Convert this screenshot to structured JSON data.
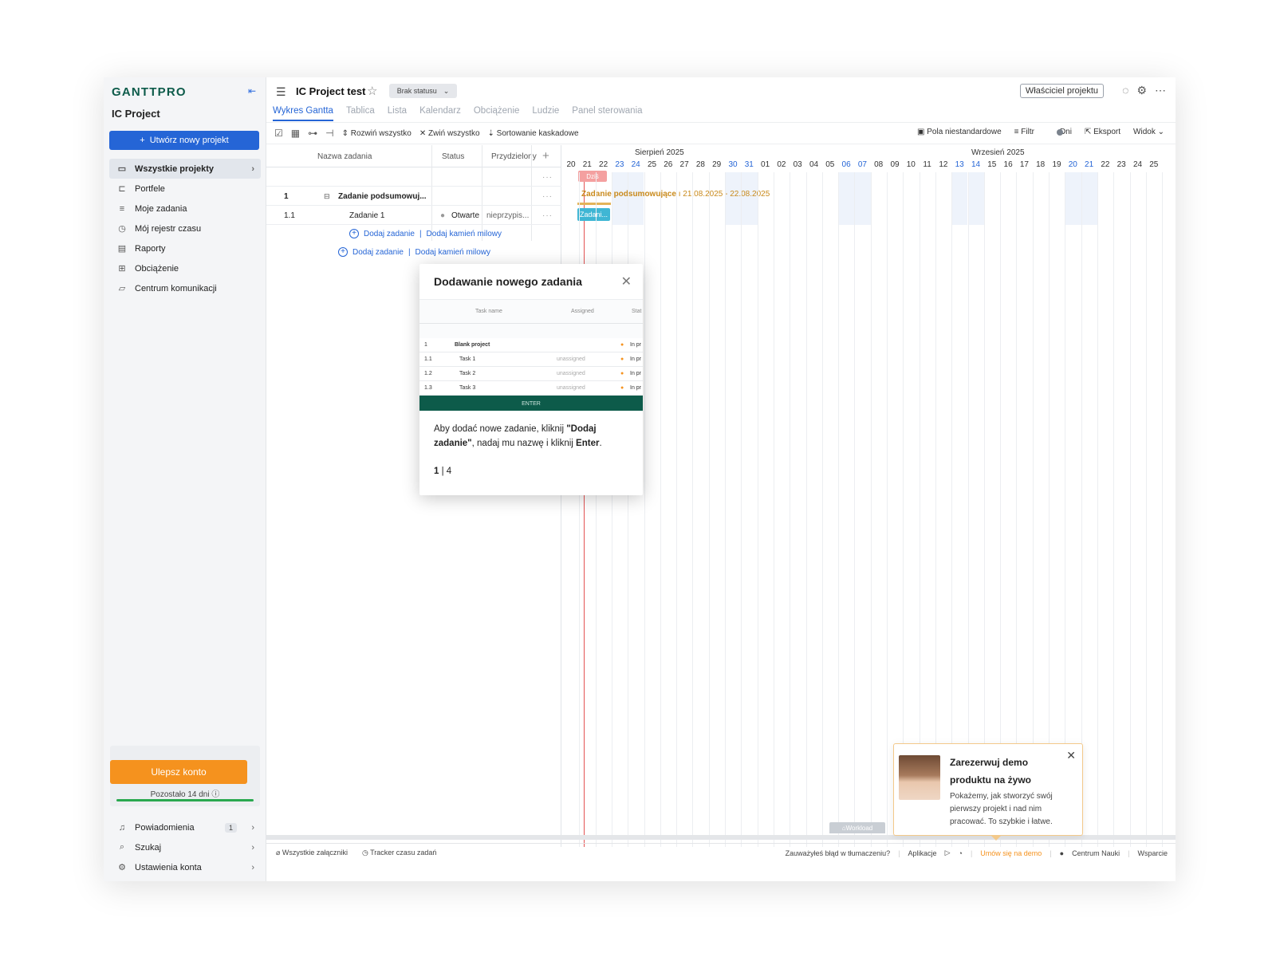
{
  "sidebar": {
    "logo": "GANTTPRO",
    "project": "IC Project",
    "new_project": "Utwórz nowy projekt",
    "items": [
      {
        "label": "Wszystkie projekty",
        "icon": "folder-icon"
      },
      {
        "label": "Portfele",
        "icon": "briefcase-icon"
      },
      {
        "label": "Moje zadania",
        "icon": "list-icon"
      },
      {
        "label": "Mój rejestr czasu",
        "icon": "clock-icon"
      },
      {
        "label": "Raporty",
        "icon": "report-icon"
      },
      {
        "label": "Obciążenie",
        "icon": "grid-icon"
      },
      {
        "label": "Centrum komunikacji",
        "icon": "chat-icon"
      }
    ],
    "upgrade": "Ulepsz konto",
    "remaining": "Pozostało 14 dni",
    "bottom": [
      {
        "label": "Powiadomienia",
        "badge": "1"
      },
      {
        "label": "Szukaj"
      },
      {
        "label": "Ustawienia konta"
      }
    ]
  },
  "header": {
    "title": "IC Project test",
    "status": "Brak statusu",
    "owner": "Właściciel projektu",
    "tabs": [
      "Wykres Gantta",
      "Tablica",
      "Lista",
      "Kalendarz",
      "Obciążenie",
      "Ludzie",
      "Panel sterowania"
    ]
  },
  "toolbar": {
    "expand_all": "Rozwiń wszystko",
    "collapse_all": "Zwiń wszystko",
    "cascade_sort": "Sortowanie kaskadowe",
    "custom_fields": "Pola niestandardowe",
    "filter": "Filtr",
    "days": "Dni",
    "export": "Eksport",
    "view": "Widok"
  },
  "grid": {
    "col_name": "Nazwa zadania",
    "col_status": "Status",
    "col_assigned": "Przydzielony",
    "rows": [
      {
        "num": "1",
        "name": "Zadanie podsumowuj...",
        "status": "",
        "assigned": ""
      },
      {
        "num": "1.1",
        "name": "Zadanie 1",
        "status": "Otwarte",
        "assigned": "nieprzypis..."
      }
    ],
    "add_task": "Dodaj zadanie",
    "add_milestone": "Dodaj kamień milowy"
  },
  "gantt": {
    "month1": "Sierpień 2025",
    "month2": "Wrzesień 2025",
    "days": [
      "20",
      "21",
      "22",
      "23",
      "24",
      "25",
      "26",
      "27",
      "28",
      "29",
      "30",
      "31",
      "01",
      "02",
      "03",
      "04",
      "05",
      "06",
      "07",
      "08",
      "09",
      "10",
      "11",
      "12",
      "13",
      "14",
      "15",
      "16",
      "17",
      "18",
      "19",
      "20",
      "21",
      "22",
      "23",
      "24",
      "25"
    ],
    "weekend_idx": [
      3,
      4,
      10,
      11,
      17,
      18,
      24,
      25,
      31,
      32
    ],
    "today": "Dziś",
    "summary_label": "Zadanie podsumowujące",
    "summary_dates": "21.08.2025 - 22.08.2025",
    "task_label": "Zadani...",
    "workload": "Workload"
  },
  "modal": {
    "title": "Dodawanie nowego zadania",
    "preview": {
      "col_task": "Task name",
      "col_assigned": "Assigned",
      "col_status": "Stat",
      "rows": [
        {
          "num": "1",
          "name": "Blank project",
          "assigned": "",
          "status": "In pr"
        },
        {
          "num": "1.1",
          "name": "Task 1",
          "assigned": "unassigned",
          "status": "In pr"
        },
        {
          "num": "1.2",
          "name": "Task 2",
          "assigned": "unassigned",
          "status": "In pr"
        },
        {
          "num": "1.3",
          "name": "Task 3",
          "assigned": "unassigned",
          "status": "In pr"
        }
      ],
      "enter": "ENTER"
    },
    "text_a": "Aby dodać nowe zadanie, kliknij ",
    "text_b": "\"Dodaj zadanie\"",
    "text_c": ", nadaj mu nazwę i kliknij ",
    "text_d": "Enter",
    "text_e": ".",
    "page_current": "1",
    "page_total": "| 4"
  },
  "footer": {
    "attachments": "Wszystkie załączniki",
    "tracker": "Tracker czasu zadań",
    "translation": "Zauważyłeś błąd w tłumaczeniu?",
    "apps": "Aplikacje",
    "demo": "Umów się na demo",
    "learning": "Centrum Nauki",
    "support": "Wsparcie"
  },
  "demo_popup": {
    "title": "Zarezerwuj demo produktu na żywo",
    "text": "Pokażemy, jak stworzyć swój pierwszy projekt i nad nim pracować. To szybkie i łatwe."
  }
}
